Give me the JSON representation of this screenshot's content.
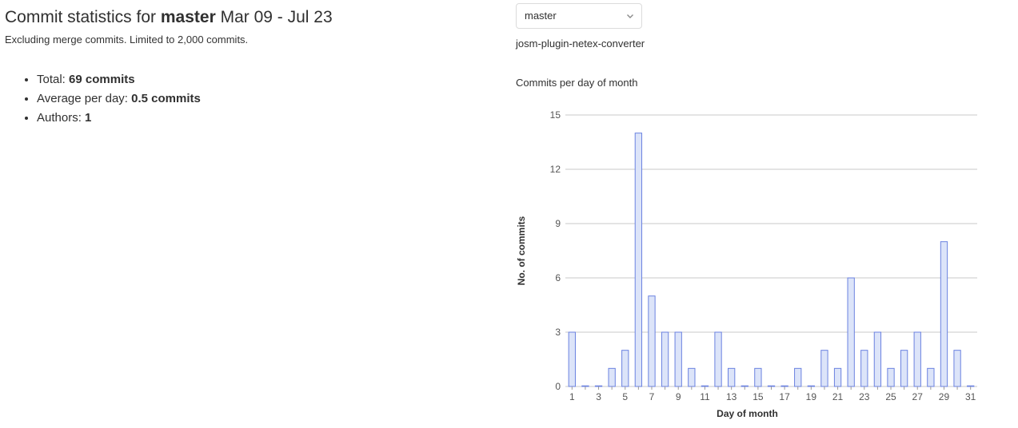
{
  "header": {
    "title_prefix": "Commit statistics for",
    "branch": "master",
    "date_range": "Mar 09 - Jul 23",
    "subtitle": "Excluding merge commits. Limited to 2,000 commits."
  },
  "stats": [
    {
      "label": "Total:",
      "value": "69 commits"
    },
    {
      "label": "Average per day:",
      "value": "0.5 commits"
    },
    {
      "label": "Authors:",
      "value": "1"
    }
  ],
  "branch_select": {
    "value": "master"
  },
  "project_name": "josm-plugin-netex-converter",
  "chart_title": "Commits per day of month",
  "colors": {
    "bar_fill": "#dce4f9",
    "bar_stroke": "#6b82e0",
    "grid": "#c8c8c8",
    "text": "#303030"
  },
  "chart_data": {
    "type": "bar",
    "title": "Commits per day of month",
    "xlabel": "Day of month",
    "ylabel": "No. of commits",
    "ylim": [
      0,
      15
    ],
    "yticks": [
      0,
      3,
      6,
      9,
      12,
      15
    ],
    "categories": [
      "1",
      "2",
      "3",
      "4",
      "5",
      "6",
      "7",
      "8",
      "9",
      "10",
      "11",
      "12",
      "13",
      "14",
      "15",
      "16",
      "17",
      "18",
      "19",
      "20",
      "21",
      "22",
      "23",
      "24",
      "25",
      "26",
      "27",
      "28",
      "29",
      "30",
      "31"
    ],
    "xticklabels": [
      "1",
      "3",
      "5",
      "7",
      "9",
      "11",
      "13",
      "15",
      "17",
      "19",
      "21",
      "23",
      "25",
      "27",
      "29",
      "31"
    ],
    "values": [
      3,
      0,
      0,
      1,
      2,
      14,
      5,
      3,
      3,
      1,
      0,
      3,
      1,
      0,
      1,
      0,
      0,
      1,
      0,
      2,
      1,
      6,
      2,
      3,
      1,
      2,
      3,
      1,
      8,
      2,
      0
    ],
    "grid": true
  }
}
